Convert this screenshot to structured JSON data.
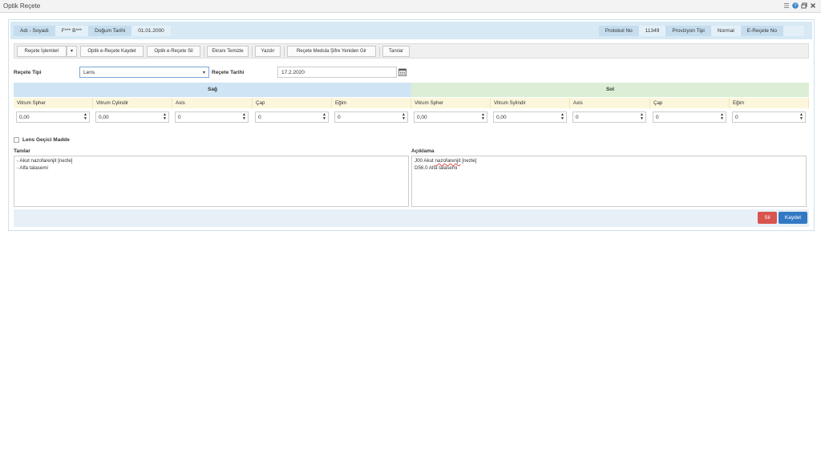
{
  "window": {
    "title": "Optik Reçete"
  },
  "patient": {
    "name_label": "Adı - Soyadı",
    "name_value": "F*** B***",
    "dob_label": "Doğum Tarihi",
    "dob_value": "01.01.2000",
    "protocol_label": "Protokol No",
    "protocol_value": "11349",
    "provision_label": "Provizyon Tipi",
    "provision_value": "Normal",
    "erecete_label": "E-Reçete No",
    "erecete_value": ""
  },
  "toolbar": {
    "islemler": "Reçete İşlemleri",
    "dropdown": "▾",
    "kaydet": "Optik e-Reçete Kaydet",
    "sil": "Optik e-Reçete Sil",
    "temizle": "Ekranı Temizle",
    "yazdir": "Yazdır",
    "medula": "Reçete Medula Şifre Yeniden Gir",
    "tanilar": "Tanılar"
  },
  "form": {
    "recete_tipi_label": "Reçete Tipi",
    "recete_tipi_value": "Lens",
    "recete_tarihi_label": "Reçete Tarihi",
    "recete_tarihi_value": "17.2.2020"
  },
  "grid": {
    "sag": "Sağ",
    "sol": "Sol",
    "sag_cols": [
      {
        "label": "Vitrum Spher",
        "value": "0,00"
      },
      {
        "label": "Vitrum Cylindir",
        "value": "0,00"
      },
      {
        "label": "Axis",
        "value": "0"
      },
      {
        "label": "Çap",
        "value": "0"
      },
      {
        "label": "Eğim",
        "value": "0"
      }
    ],
    "sol_cols": [
      {
        "label": "Vitrum Spher",
        "value": "0,00"
      },
      {
        "label": "Vitrum Sylindir",
        "value": "0,00"
      },
      {
        "label": "Axis",
        "value": "0"
      },
      {
        "label": "Çap",
        "value": "0"
      },
      {
        "label": "Eğim",
        "value": "0"
      }
    ]
  },
  "lens_gecici": "Lens Geçici Madde",
  "tanilar": {
    "label": "Tanılar",
    "lines": [
      "- Akut nazofarenjit [nezle]",
      "- Alfa talasemi"
    ]
  },
  "aciklama": {
    "label": "Açıklama",
    "line1_pre": "J00 Akut ",
    "line1_word": "nazofarenjit",
    "line1_post": " [nezle]",
    "line2": "D56.0 Alfa talasemi"
  },
  "actions": {
    "sil": "Sil",
    "kaydet": "Kaydet"
  },
  "colors": {
    "accent": "#3279c3",
    "danger": "#d9534f",
    "sag_header": "#cfe5f5",
    "sol_header": "#dcefd6"
  }
}
